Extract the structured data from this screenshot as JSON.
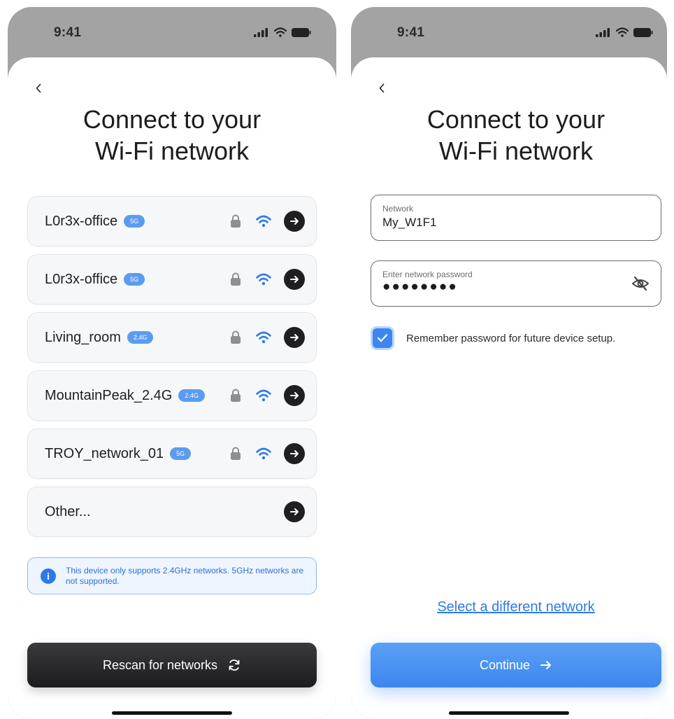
{
  "status_bar": {
    "time": "9:41"
  },
  "left_screen": {
    "title": "Connect to your\nWi-Fi network",
    "networks": [
      {
        "name": "L0r3x-office",
        "band": "5G",
        "secured": true
      },
      {
        "name": "L0r3x-office",
        "band": "5G",
        "secured": true
      },
      {
        "name": "Living_room",
        "band": "2.4G",
        "secured": true
      },
      {
        "name": "MountainPeak_2.4G",
        "band": "2.4G",
        "secured": true
      },
      {
        "name": "TROY_network_01",
        "band": "5G",
        "secured": true
      },
      {
        "name": "Other..."
      }
    ],
    "info_text": "This device only supports 2.4GHz networks. 5GHz networks are not supported.",
    "rescan_label": "Rescan for networks"
  },
  "right_screen": {
    "title": "Connect to your\nWi-Fi network",
    "network_field": {
      "label": "Network",
      "value": "My_W1F1"
    },
    "password_field": {
      "label": "Enter network password",
      "value": "●●●●●●●●"
    },
    "remember_label": "Remember password for future device setup.",
    "remember_checked": true,
    "select_link": "Select a different network",
    "continue_label": "Continue"
  },
  "colors": {
    "accent": "#3d86ee",
    "badge": "#5b9cf0",
    "dark_button": "#1c1c1e",
    "info_text": "#2d6fd8"
  }
}
